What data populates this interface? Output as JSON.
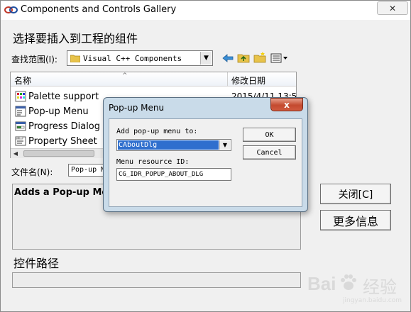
{
  "window": {
    "title": "Components and Controls Gallery",
    "close_glyph": "✕"
  },
  "instruction": "选择要插入到工程的组件",
  "look_in": {
    "label": "查找范围(I):",
    "value": "Visual C++ Components"
  },
  "file_list": {
    "col_name": "名称",
    "col_date": "修改日期",
    "rows": [
      {
        "name": "Palette support",
        "date": "2015/4/11 13:5(",
        "icon": "palette-icon"
      },
      {
        "name": "Pop-up Menu",
        "date": "",
        "icon": "popup-menu-icon"
      },
      {
        "name": "Progress Dialog",
        "date": "",
        "icon": "progress-icon"
      },
      {
        "name": "Property Sheet",
        "date": "",
        "icon": "property-sheet-icon"
      }
    ]
  },
  "file_name": {
    "label": "文件名(N):",
    "value": "Pop-up M"
  },
  "description": "Adds a Pop-up Menu",
  "path_label": "控件路径",
  "buttons": {
    "close": "关闭[C]",
    "more_info": "更多信息"
  },
  "popup": {
    "title": "Pop-up Menu",
    "close_glyph": "x",
    "add_label": "Add pop-up menu to:",
    "add_value": "CAboutDlg",
    "resource_label": "Menu resource ID:",
    "resource_value": "CG_IDR_POPUP_ABOUT_DLG",
    "ok": "OK",
    "cancel": "Cancel"
  },
  "watermark": {
    "brand": "Bai",
    "cn": "经验",
    "url": "jingyan.baidu.com"
  },
  "colors": {
    "selection": "#2f6fce",
    "popup_frame": "#c9dbe9",
    "close_red": "#c44a2f"
  }
}
